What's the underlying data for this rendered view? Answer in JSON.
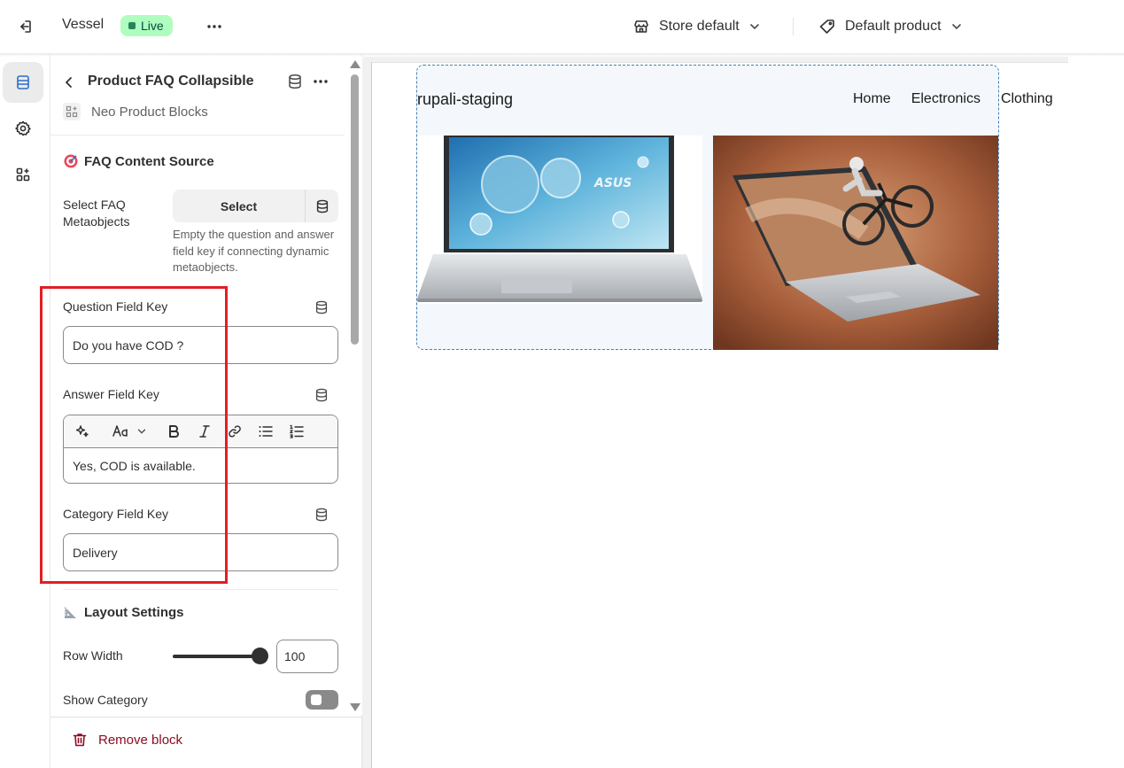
{
  "topbar": {
    "theme_name": "Vessel",
    "live_label": "Live",
    "store_selector": "Store default",
    "product_selector": "Default product"
  },
  "panel": {
    "block_title": "Product FAQ Collapsible",
    "app_name": "Neo Product Blocks",
    "faq_section_title": "FAQ Content Source",
    "select_faq_label": "Select FAQ Metaobjects",
    "select_button": "Select",
    "select_help": "Empty the question and answer field key if connecting dynamic metaobjects.",
    "question_label": "Question Field Key",
    "question_value": "Do you have COD ?",
    "answer_label": "Answer Field Key",
    "answer_value": "Yes, COD is available.",
    "category_label": "Category Field Key",
    "category_value": "Delivery",
    "layout_section_title": "Layout Settings",
    "row_width_label": "Row Width",
    "row_width_value": "100",
    "row_width_fraction": 1.0,
    "show_category_label": "Show Category",
    "show_category_on": false,
    "remove_label": "Remove block"
  },
  "preview": {
    "store_logo": "rupali-staging",
    "nav": [
      "Home",
      "Electronics",
      "Clothing"
    ],
    "laptop_brand": "ASUS"
  },
  "colors": {
    "accent_highlight": "#e01e26",
    "live_bg": "#affebf",
    "remove_text": "#8e0b21"
  }
}
